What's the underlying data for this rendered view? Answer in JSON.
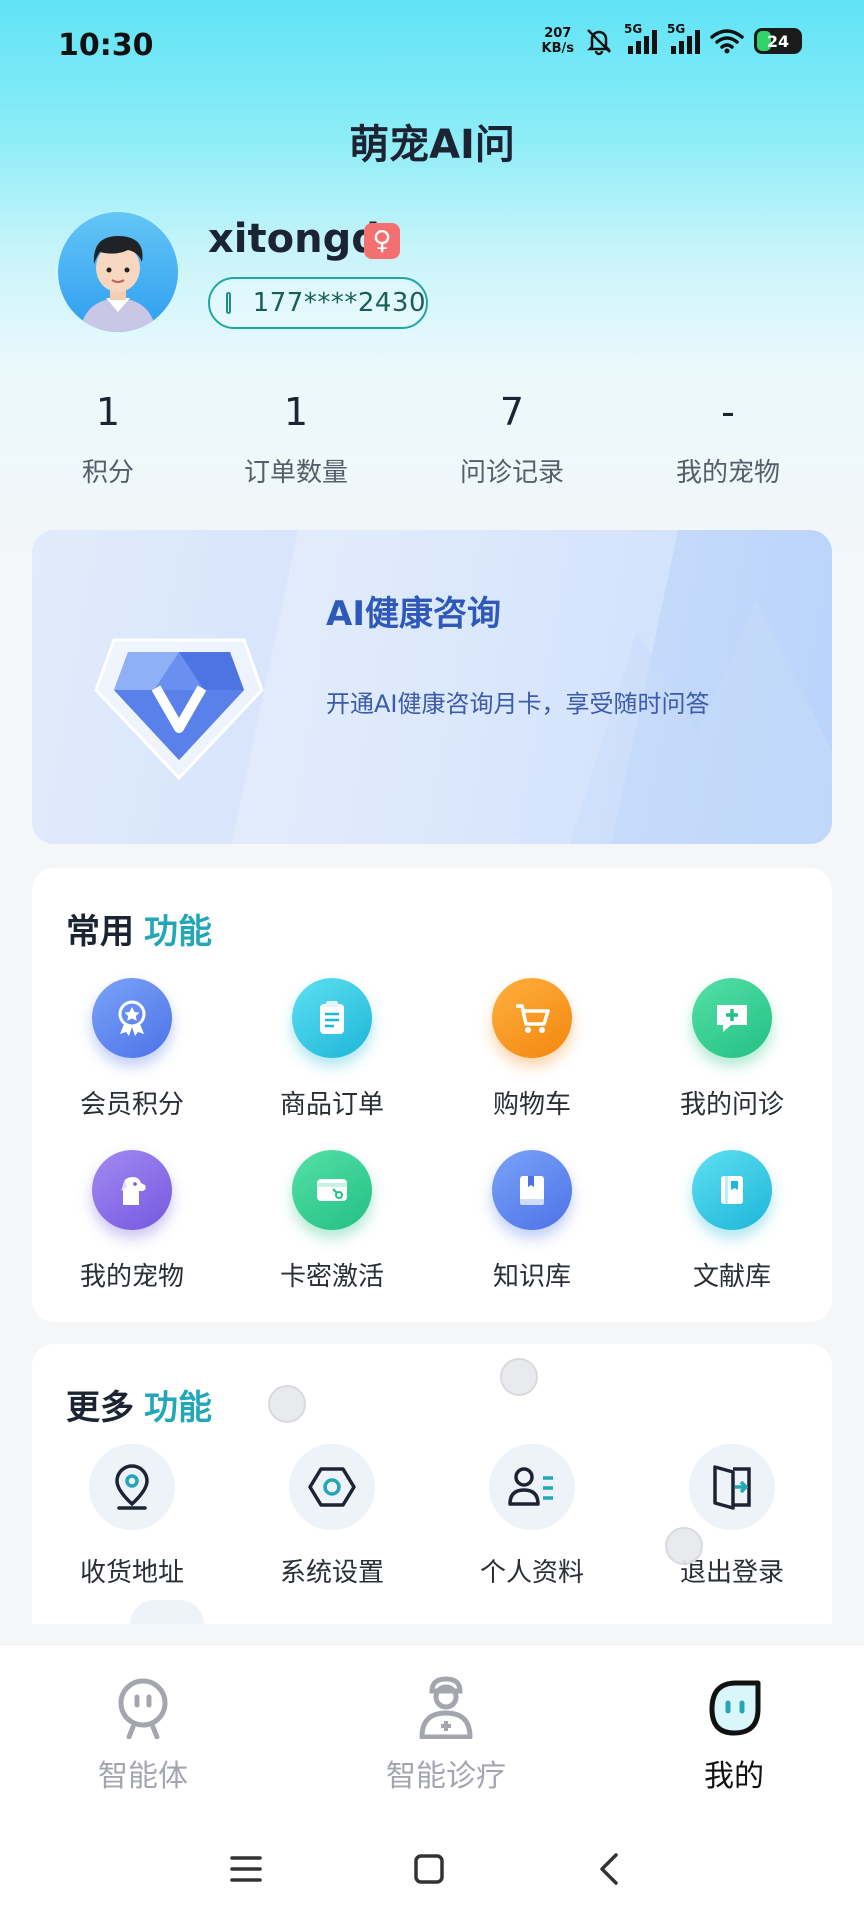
{
  "status_bar": {
    "time": "10:30",
    "net_speed_value": "207",
    "net_speed_unit": "KB/s",
    "signal1_label": "5G",
    "signal2_label": "5G",
    "battery": "24"
  },
  "app_title": "萌宠AI问",
  "profile": {
    "username": "xitongd",
    "gender_symbol": "♀",
    "phone": "177****2430"
  },
  "stats": [
    {
      "value": "1",
      "label": "积分"
    },
    {
      "value": "1",
      "label": "订单数量"
    },
    {
      "value": "7",
      "label": "问诊记录"
    },
    {
      "value": "-",
      "label": "我的宠物"
    }
  ],
  "banner": {
    "title": "AI健康咨询",
    "subtitle": "开通AI健康咨询月卡，享受随时问答",
    "page_count": 14,
    "active_index": 0
  },
  "common_section": {
    "title_main": "常用",
    "title_accent": "功能",
    "items": [
      {
        "label": "会员积分",
        "icon": "member-points-icon",
        "color": "#5b86f0"
      },
      {
        "label": "商品订单",
        "icon": "product-order-icon",
        "color": "#2cc8e4"
      },
      {
        "label": "购物车",
        "icon": "cart-icon",
        "color": "#f7941e"
      },
      {
        "label": "我的问诊",
        "icon": "consult-icon",
        "color": "#2fcf8f"
      },
      {
        "label": "我的宠物",
        "icon": "pet-icon",
        "color": "#8a6ce8"
      },
      {
        "label": "卡密激活",
        "icon": "card-activate-icon",
        "color": "#2fcf8f"
      },
      {
        "label": "知识库",
        "icon": "knowledge-base-icon",
        "color": "#5b86f0"
      },
      {
        "label": "文献库",
        "icon": "literature-icon",
        "color": "#2cc8e4"
      }
    ]
  },
  "more_section": {
    "title_main": "更多",
    "title_accent": "功能",
    "items": [
      {
        "label": "收货地址",
        "icon": "location-icon"
      },
      {
        "label": "系统设置",
        "icon": "settings-icon"
      },
      {
        "label": "个人资料",
        "icon": "profile-icon"
      },
      {
        "label": "退出登录",
        "icon": "logout-icon"
      }
    ]
  },
  "bottom_nav": {
    "items": [
      {
        "label": "智能体",
        "icon": "agent-icon",
        "active": false
      },
      {
        "label": "智能诊疗",
        "icon": "doctor-icon",
        "active": false
      },
      {
        "label": "我的",
        "icon": "mine-icon",
        "active": true
      }
    ]
  },
  "colors": {
    "accent": "#22a6b8",
    "banner_title": "#2e59b8",
    "gender_badge": "#f46f6f"
  }
}
